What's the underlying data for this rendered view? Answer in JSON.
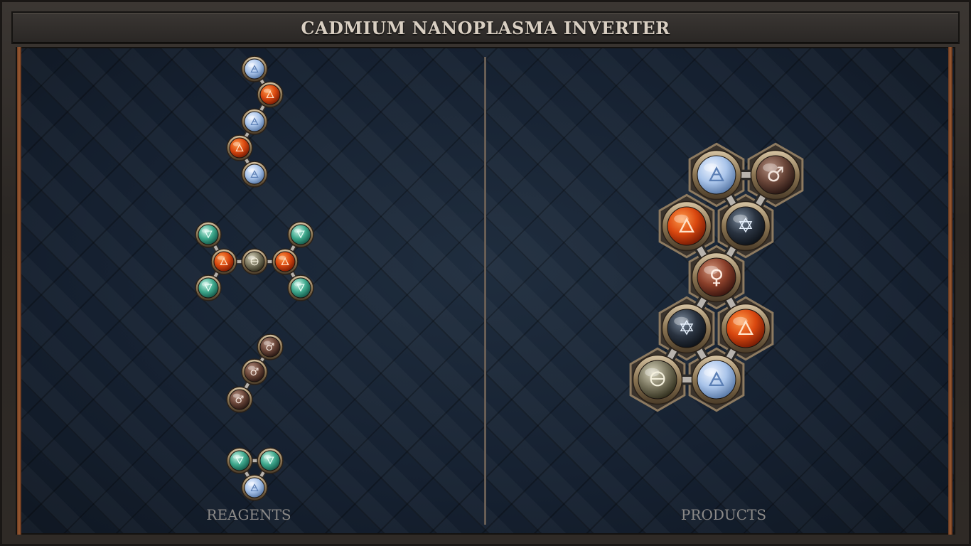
{
  "title": "CADMIUM NANOPLASMA INVERTER",
  "labels": {
    "reagents": "REAGENTS",
    "products": "PRODUCTS"
  },
  "element_styles": {
    "air": {
      "symbol": "🜁",
      "c1": "#eef4ff",
      "c2": "#a9c4ea",
      "c3": "#5a7aa8",
      "sym": "#5b7fb5"
    },
    "fire": {
      "symbol": "🜂",
      "c1": "#ff9a4a",
      "c2": "#d9470f",
      "c3": "#7a1d05",
      "sym": "#ffe2c8"
    },
    "water": {
      "symbol": "🜄",
      "c1": "#c9f3e6",
      "c2": "#3ea88c",
      "c3": "#145a4b",
      "sym": "#e8fff8"
    },
    "salt": {
      "symbol": "🜔",
      "c1": "#d8d4bc",
      "c2": "#7b7760",
      "c3": "#33311f",
      "sym": "#f5f1de"
    },
    "iron": {
      "symbol": "♂",
      "c1": "#b48f80",
      "c2": "#6a4639",
      "c3": "#2a1814",
      "sym": "#f2e4dc"
    },
    "copper": {
      "symbol": "♀",
      "c1": "#d2957a",
      "c2": "#8a3f2a",
      "c3": "#3d1710",
      "sym": "#ffeee4"
    },
    "quint": {
      "symbol": "✡",
      "c1": "#7b8a9c",
      "c2": "#2a3340",
      "c3": "#0e131a",
      "sym": "#e9f3ff"
    }
  }
}
